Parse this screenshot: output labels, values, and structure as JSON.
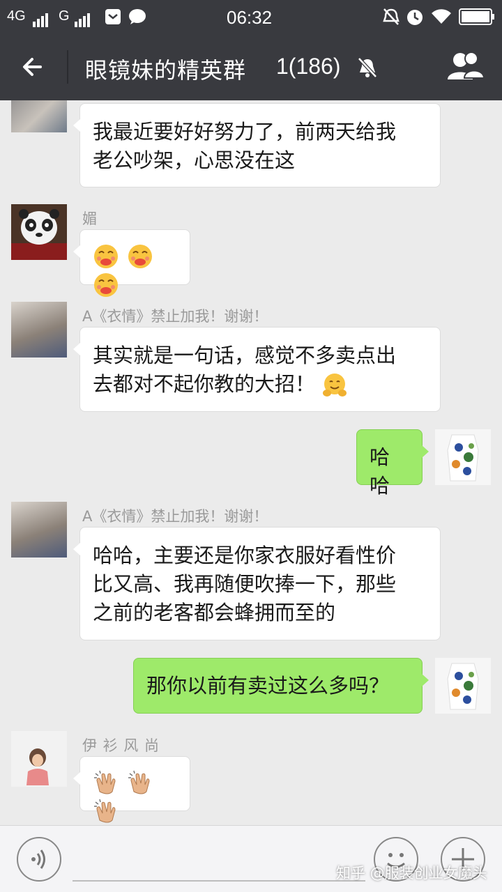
{
  "status_bar": {
    "net1": "4G",
    "net2": "G",
    "time": "06:32",
    "icons": [
      "signal-icon",
      "sim-icon",
      "message-icon",
      "alarm-off-icon",
      "clock-icon",
      "wifi-icon",
      "battery-icon"
    ]
  },
  "header": {
    "title": "眼镜妹的精英群",
    "member_count": "1(186)",
    "icons": [
      "back-arrow-icon",
      "mute-bell-icon",
      "group-members-icon"
    ]
  },
  "messages": [
    {
      "side": "in",
      "sender": "",
      "text_lines": [
        "我最近要好好努力了，前两天给我",
        "老公吵架，心思没在这"
      ]
    },
    {
      "side": "in",
      "sender": "媚",
      "emoji": [
        "giggle-emoji",
        "giggle-emoji",
        "giggle-emoji"
      ]
    },
    {
      "side": "in",
      "sender": "A《衣情》禁止加我！谢谢！",
      "text_lines": [
        "其实就是一句话，感觉不多卖点出",
        "去都对不起你教的大招！"
      ],
      "trailing_emoji": "hug-emoji"
    },
    {
      "side": "out",
      "text": "哈哈"
    },
    {
      "side": "in",
      "sender": "A《衣情》禁止加我！谢谢！",
      "text_lines": [
        "哈哈，主要还是你家衣服好看性价",
        "比又高、我再随便吹捧一下，那些",
        "之前的老客都会蜂拥而至的"
      ]
    },
    {
      "side": "out",
      "text": "那你以前有卖过这么多吗？"
    },
    {
      "side": "in",
      "sender": "伊 衫 风 尚",
      "emoji": [
        "clap-emoji",
        "clap-emoji",
        "clap-emoji"
      ]
    }
  ],
  "input_bar": {
    "icons": [
      "voice-icon",
      "emoji-icon",
      "plus-icon"
    ]
  },
  "watermark": "知乎 @服装创业女魔头",
  "colors": {
    "header_bg": "#393a3f",
    "chat_bg": "#ebebeb",
    "out_bubble": "#9eea6a",
    "in_bubble": "#ffffff"
  }
}
